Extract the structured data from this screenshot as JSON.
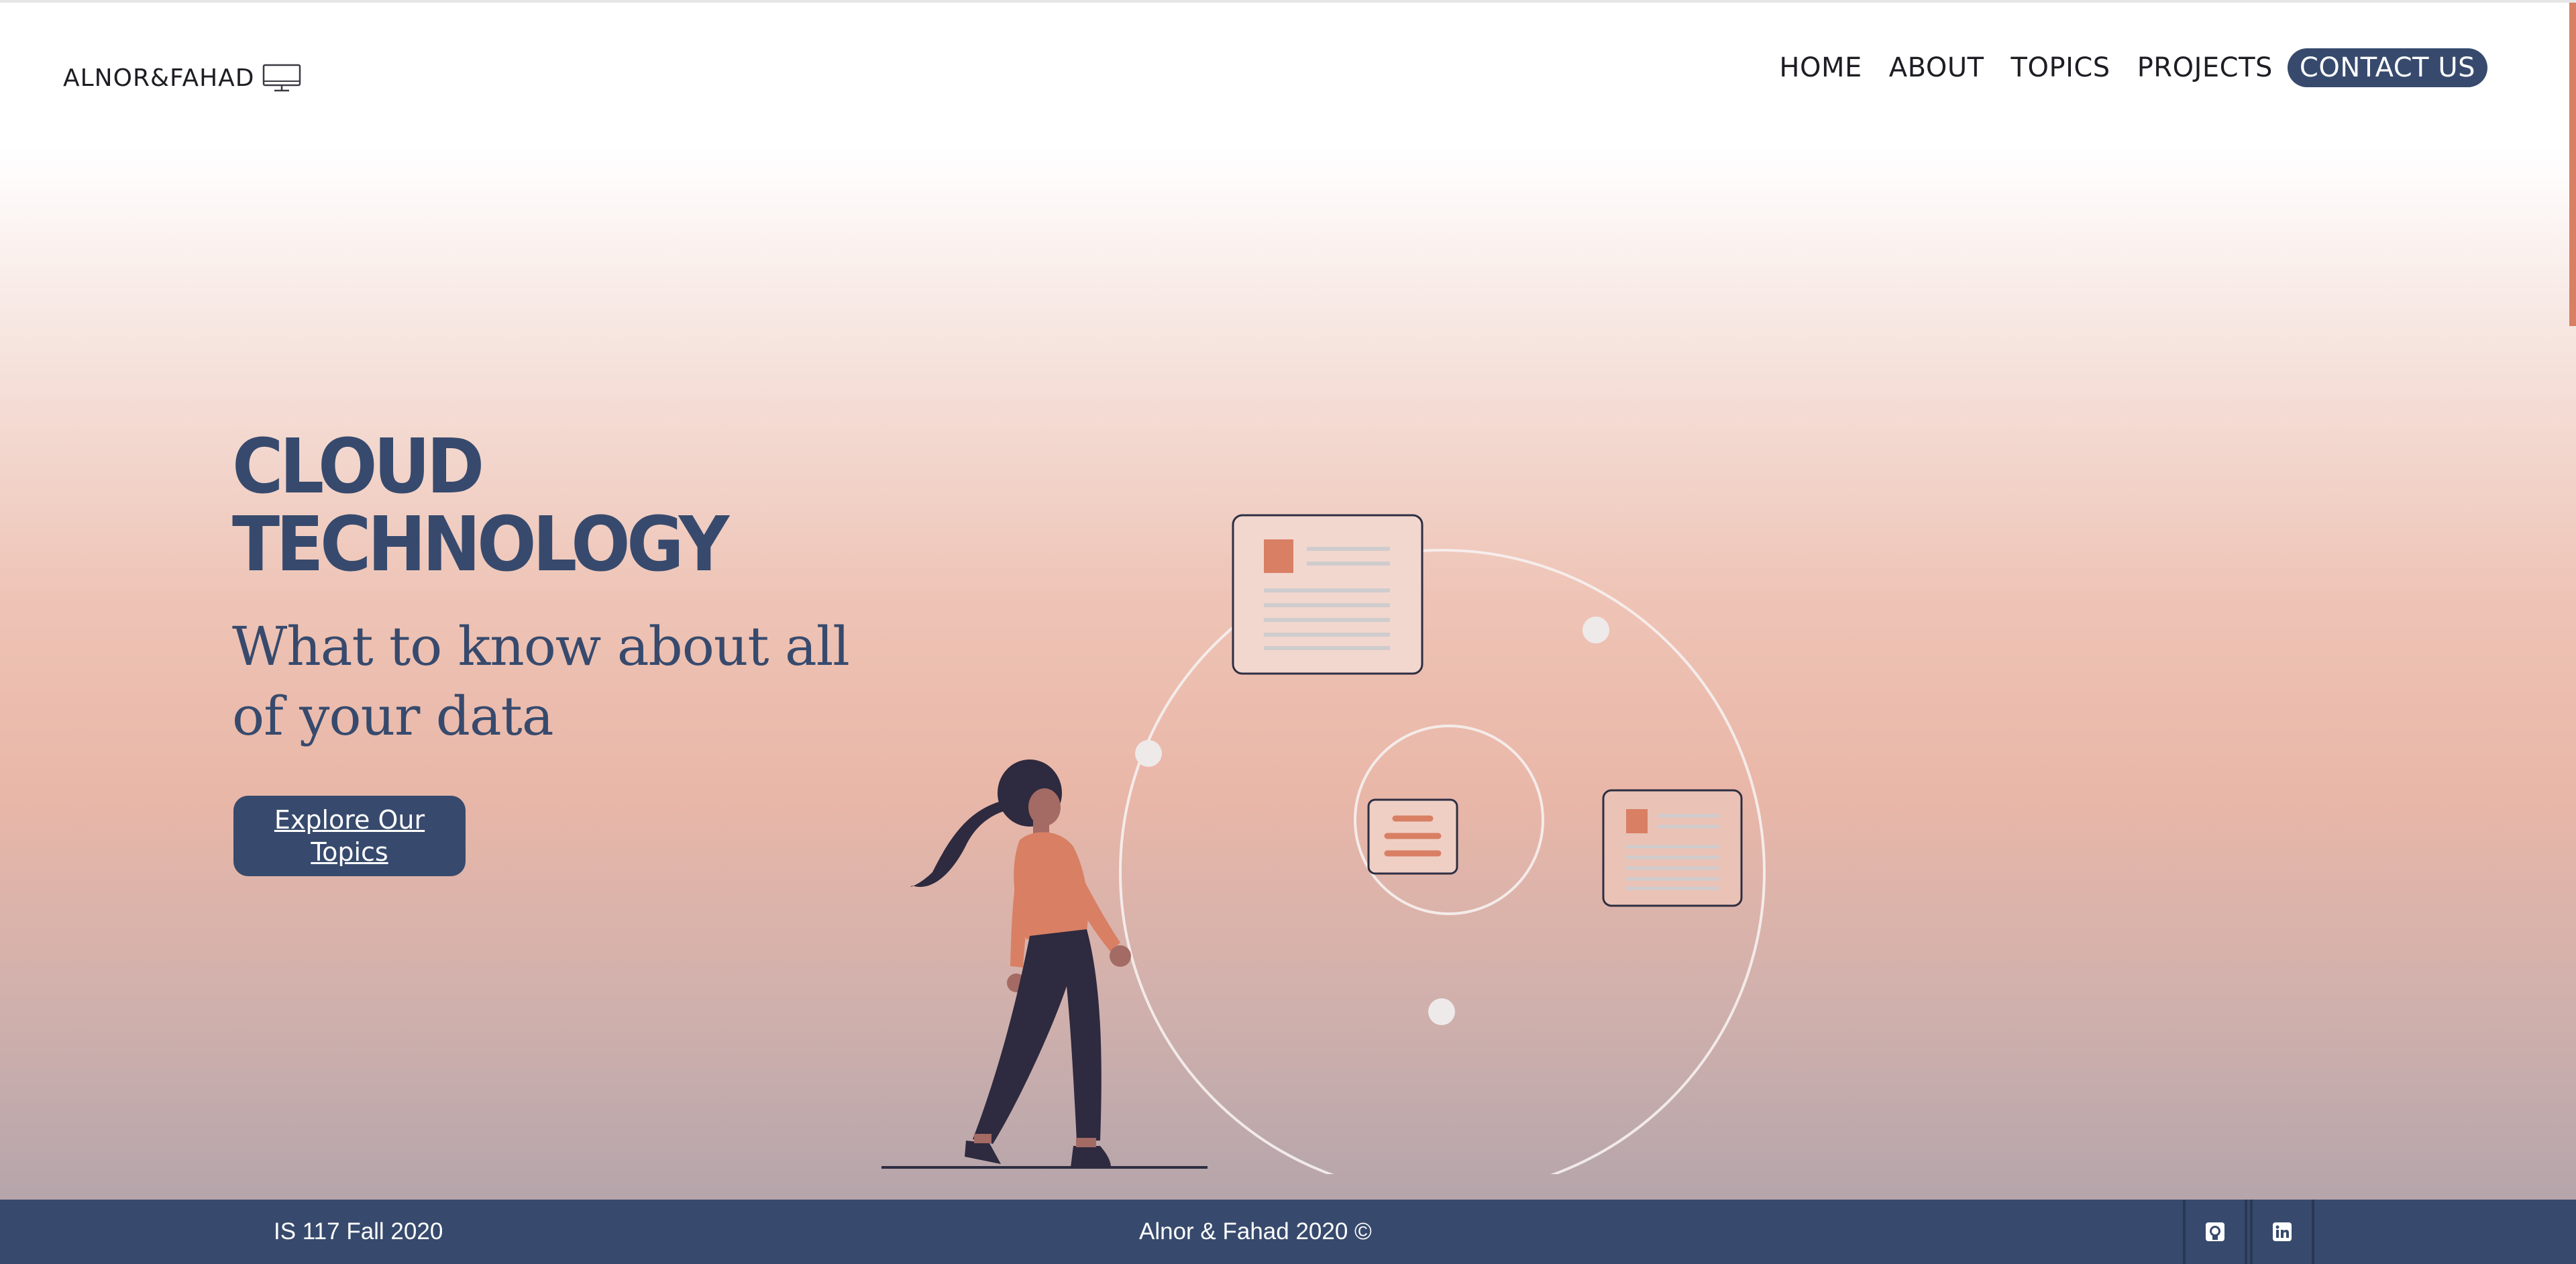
{
  "header": {
    "logo_text": "ALNOR&FAHAD",
    "logo_icon": "desktop-monitor-icon",
    "nav": [
      {
        "label": "HOME"
      },
      {
        "label": "ABOUT"
      },
      {
        "label": "TOPICS"
      },
      {
        "label": "PROJECTS"
      },
      {
        "label": "CONTACT US"
      }
    ]
  },
  "hero": {
    "title_line1": "CLOUD",
    "title_line2": "TECHNOLOGY",
    "subtitle": "What to know about all of your data",
    "cta_label": "Explore Our Topics"
  },
  "footer": {
    "left_text": "IS 117 Fall 2020",
    "center_text": "Alnor & Fahad 2020 ©",
    "social_icons": [
      "github-icon",
      "linkedin-icon"
    ]
  },
  "colors": {
    "navy": "#374a6d",
    "accent": "#d87f64",
    "text_dark": "#1d1d24"
  }
}
